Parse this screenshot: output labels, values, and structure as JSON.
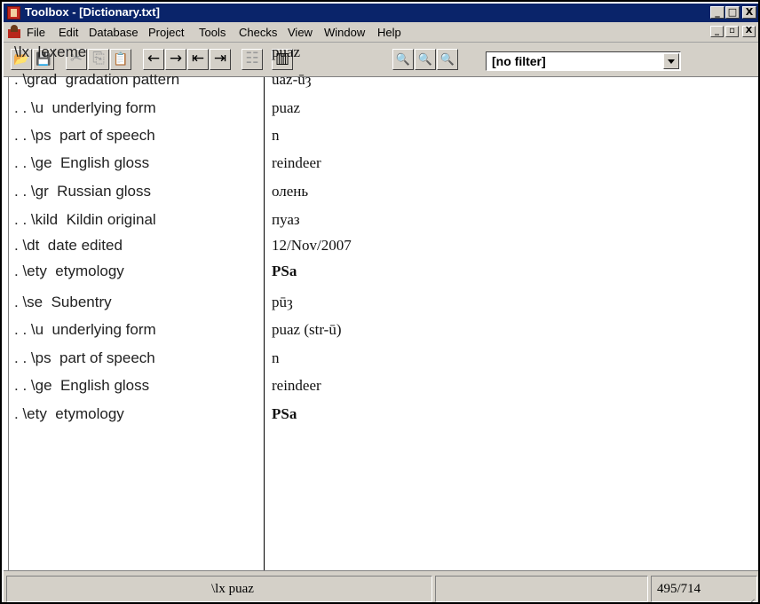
{
  "window": {
    "title": "Toolbox - [Dictionary.txt]",
    "controls": {
      "minimize": "_",
      "maximize": "□",
      "close": "X"
    },
    "mdi_controls": {
      "minimize": "_",
      "restore": "▫",
      "close": "X"
    }
  },
  "menu": {
    "items": [
      "File",
      "Edit",
      "Database",
      "Project",
      "Tools",
      "Checks",
      "View",
      "Window",
      "Help"
    ]
  },
  "toolbar": {
    "buttons": [
      {
        "icon": "open-folder-icon",
        "glyph": "📂",
        "enabled": true
      },
      {
        "icon": "save-icon",
        "glyph": "💾",
        "enabled": true
      },
      {
        "icon": "cut-icon",
        "glyph": "✂",
        "enabled": false
      },
      {
        "icon": "copy-icon",
        "glyph": "⎘",
        "enabled": false
      },
      {
        "icon": "paste-icon",
        "glyph": "📋",
        "enabled": true
      },
      {
        "icon": "previous-record-icon",
        "glyph": "←",
        "enabled": true
      },
      {
        "icon": "next-record-icon",
        "glyph": "→",
        "enabled": true
      },
      {
        "icon": "first-record-icon",
        "glyph": "⇤",
        "enabled": true
      },
      {
        "icon": "last-record-icon",
        "glyph": "⇥",
        "enabled": true
      },
      {
        "icon": "browse-icon",
        "glyph": "☷",
        "enabled": false
      },
      {
        "icon": "record-view-icon",
        "glyph": "▥",
        "enabled": true
      },
      {
        "icon": "find-previous-icon",
        "glyph": "🔍",
        "enabled": true
      },
      {
        "icon": "find-icon",
        "glyph": "🔍",
        "enabled": true
      },
      {
        "icon": "find-next-icon",
        "glyph": "🔍",
        "enabled": true
      }
    ],
    "filter": {
      "value": "[no filter]"
    }
  },
  "record": {
    "fields": [
      {
        "marker": "\\lx  lexeme",
        "value": "puaz"
      },
      {
        "marker": ". \\grad  gradation pattern",
        "value": "uaz-ūȝ"
      },
      {
        "marker": ". . \\u  underlying form",
        "value": "puaz"
      },
      {
        "marker": ". . \\ps  part of speech",
        "value": "n"
      },
      {
        "marker": ". . \\ge  English gloss",
        "value": "reindeer"
      },
      {
        "marker": ". . \\gr  Russian gloss",
        "value": "олень"
      },
      {
        "marker": ". . \\kild  Kildin original",
        "value": "пуаз"
      },
      {
        "marker": ". \\dt  date edited",
        "value": "12/Nov/2007"
      },
      {
        "marker": ". \\ety  etymology",
        "value": "PSa",
        "bold": true
      },
      {
        "marker": ". \\se  Subentry",
        "value": "pūȝ"
      },
      {
        "marker": ". . \\u  underlying form",
        "value": "puaz (str-ū)"
      },
      {
        "marker": ". . \\ps  part of speech",
        "value": "n"
      },
      {
        "marker": ". . \\ge  English gloss",
        "value": "reindeer"
      },
      {
        "marker": ". \\ety  etymology",
        "value": "PSa",
        "bold": true
      }
    ]
  },
  "status": {
    "current_record": "\\lx puaz",
    "position": "495/714"
  }
}
